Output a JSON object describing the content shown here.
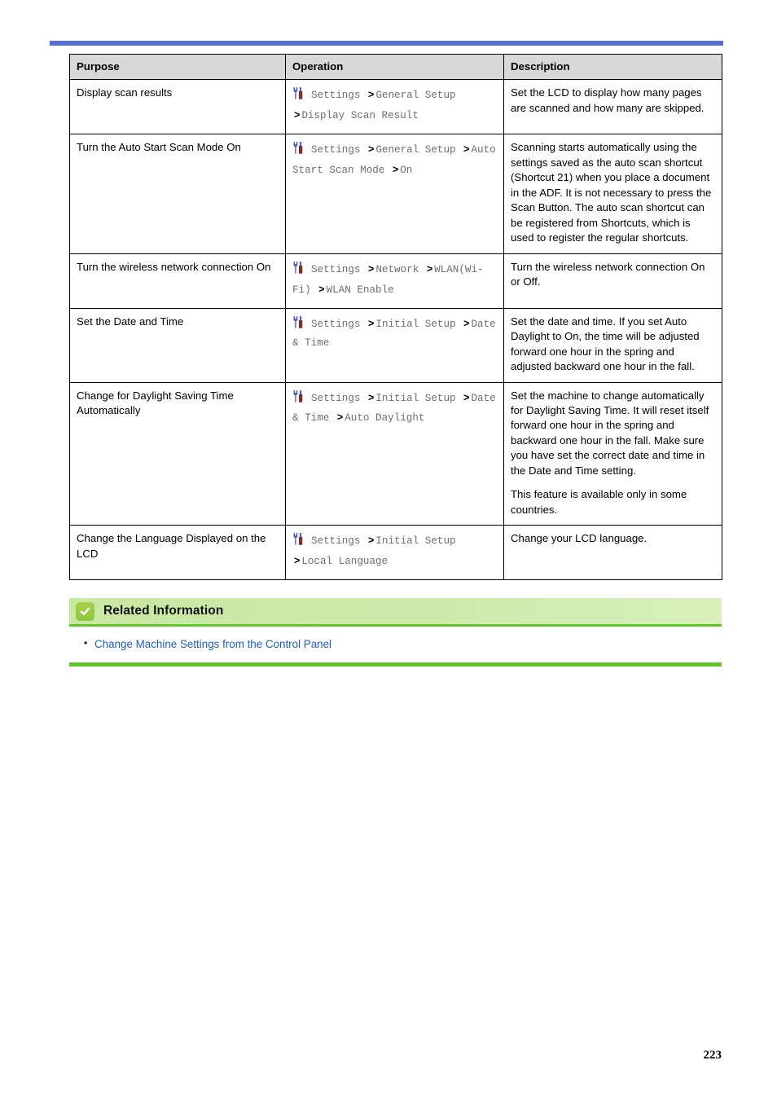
{
  "page": {
    "number": "223",
    "accent_blue": "#5570cf",
    "header_gray": "#d8d8d8",
    "related_green": "#5fc52a",
    "link_blue": "#1a5fbf"
  },
  "table": {
    "headers": {
      "purpose": "Purpose",
      "operation": "Operation",
      "description": "Description"
    },
    "rows": [
      {
        "purpose": "Display scan results",
        "icon": "settings-tools-icon",
        "path": [
          {
            "text": "Settings",
            "type": "item"
          },
          {
            "text": ">",
            "type": "sep"
          },
          {
            "text": "General Setup",
            "type": "item"
          },
          {
            "text": ">",
            "type": "sep"
          },
          {
            "text": "Display Scan Result",
            "type": "item"
          }
        ],
        "description": [
          "Set the LCD to display how many pages are scanned and how many are skipped."
        ]
      },
      {
        "purpose": "Turn the Auto Start Scan Mode On",
        "icon": "settings-tools-icon",
        "path": [
          {
            "text": "Settings",
            "type": "item"
          },
          {
            "text": ">",
            "type": "sep"
          },
          {
            "text": "General Setup",
            "type": "item"
          },
          {
            "text": ">",
            "type": "sep"
          },
          {
            "text": "Auto Start Scan Mode",
            "type": "item"
          },
          {
            "text": ">",
            "type": "sep"
          },
          {
            "text": "On",
            "type": "item"
          }
        ],
        "description": [
          "Scanning starts automatically using the settings saved as the auto scan shortcut (Shortcut 21) when you place a document in the ADF. It is not necessary to press the Scan Button. The auto scan shortcut can be registered from Shortcuts, which is used to register the regular shortcuts."
        ]
      },
      {
        "purpose": "Turn the wireless network connection On",
        "icon": "settings-tools-icon",
        "path": [
          {
            "text": "Settings",
            "type": "item"
          },
          {
            "text": ">",
            "type": "sep"
          },
          {
            "text": "Network",
            "type": "item"
          },
          {
            "text": ">",
            "type": "sep"
          },
          {
            "text": "WLAN(Wi-Fi)",
            "type": "item"
          },
          {
            "text": ">",
            "type": "sep"
          },
          {
            "text": "WLAN Enable",
            "type": "item"
          }
        ],
        "description": [
          "Turn the wireless network connection On or Off."
        ]
      },
      {
        "purpose": "Set the Date and Time",
        "icon": "settings-tools-icon",
        "path": [
          {
            "text": "Settings",
            "type": "item"
          },
          {
            "text": ">",
            "type": "sep"
          },
          {
            "text": "Initial Setup",
            "type": "item"
          },
          {
            "text": ">",
            "type": "sep"
          },
          {
            "text": "Date & Time",
            "type": "item"
          }
        ],
        "description": [
          "Set the date and time. If you set Auto Daylight to On, the time will be adjusted forward one hour in the spring and adjusted backward one hour in the fall."
        ]
      },
      {
        "purpose": "Change for Daylight Saving Time Automatically",
        "icon": "settings-tools-icon",
        "path": [
          {
            "text": "Settings",
            "type": "item"
          },
          {
            "text": ">",
            "type": "sep"
          },
          {
            "text": "Initial Setup",
            "type": "item"
          },
          {
            "text": ">",
            "type": "sep"
          },
          {
            "text": "Date & Time",
            "type": "item"
          },
          {
            "text": ">",
            "type": "sep"
          },
          {
            "text": "Auto Daylight",
            "type": "item"
          }
        ],
        "description": [
          "Set the machine to change automatically for Daylight Saving Time. It will reset itself forward one hour in the spring and backward one hour in the fall. Make sure you have set the correct date and time in the Date and Time setting.",
          "This feature is available only in some countries."
        ]
      },
      {
        "purpose": "Change the Language Displayed on the LCD",
        "icon": "settings-tools-icon",
        "path": [
          {
            "text": "Settings",
            "type": "item"
          },
          {
            "text": ">",
            "type": "sep"
          },
          {
            "text": "Initial Setup",
            "type": "item"
          },
          {
            "text": ">",
            "type": "sep"
          },
          {
            "text": "Local Language",
            "type": "item"
          }
        ],
        "description": [
          "Change your LCD language."
        ]
      }
    ]
  },
  "related_information": {
    "icon": "check-badge-icon",
    "title": "Related Information",
    "links": [
      "Change Machine Settings from the Control Panel"
    ]
  }
}
